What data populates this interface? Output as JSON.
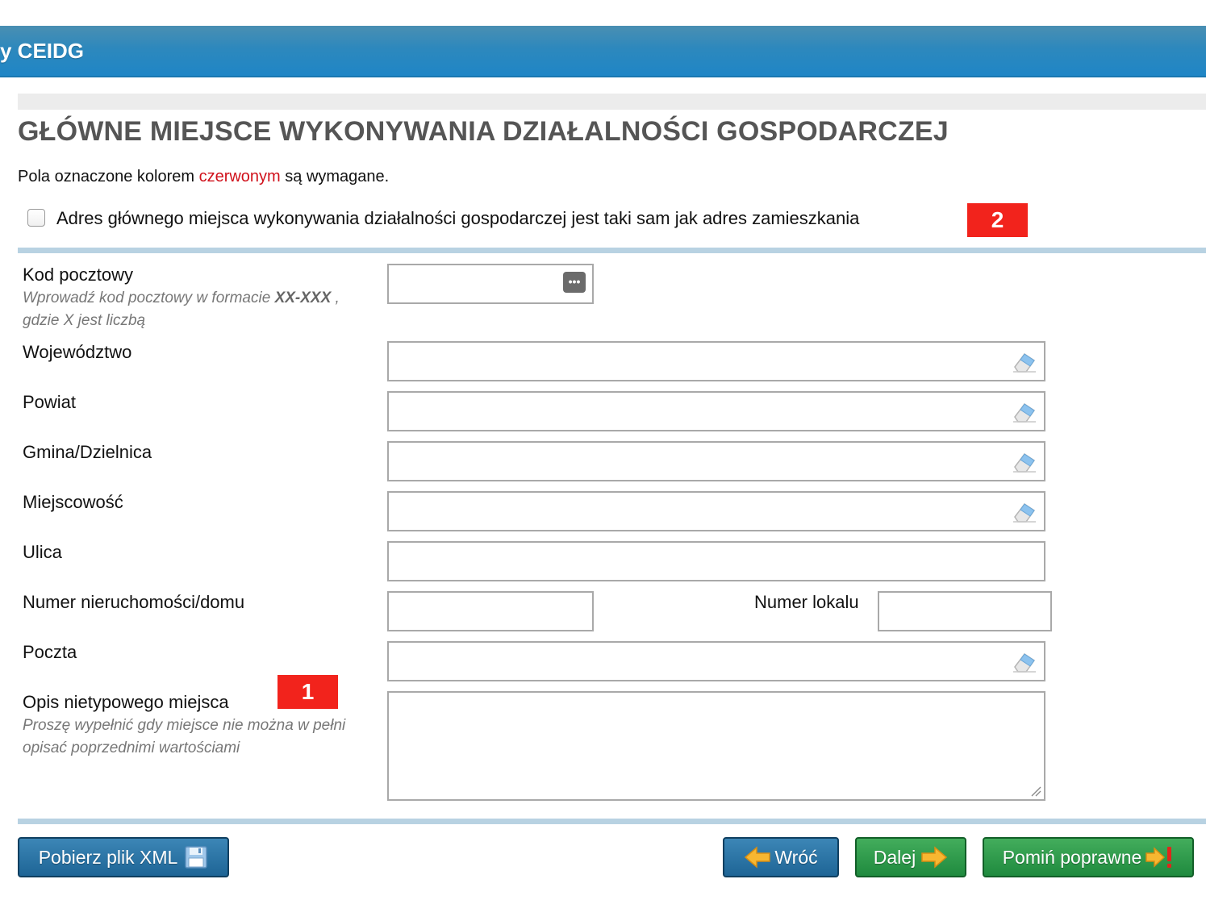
{
  "header": {
    "title": "y CEIDG"
  },
  "section": {
    "heading": "GŁÓWNE MIEJSCE WYKONYWANIA DZIAŁALNOŚCI GOSPODARCZEJ",
    "note_prefix": "Pola oznaczone kolorem ",
    "note_required_word": "czerwonym",
    "note_suffix": " są wymagane.",
    "required_color": "#d0111b"
  },
  "same_address": {
    "label": "Adres głównego miejsca wykonywania działalności gospodarczej jest taki sam jak adres zamieszkania",
    "checked": false
  },
  "badges": {
    "badge_2": "2",
    "badge_1": "1"
  },
  "form": {
    "kod_pocztowy": {
      "label": "Kod pocztowy",
      "hint_1": "Wprowadź kod pocztowy w formacie ",
      "hint_format": "XX-XXX",
      "hint_2": " ,",
      "hint_3": "gdzie X jest liczbą",
      "value": ""
    },
    "wojewodztwo": {
      "label": "Województwo",
      "value": ""
    },
    "powiat": {
      "label": "Powiat",
      "value": ""
    },
    "gmina": {
      "label": "Gmina/Dzielnica",
      "value": ""
    },
    "miejscowosc": {
      "label": "Miejscowość",
      "value": ""
    },
    "ulica": {
      "label": "Ulica",
      "value": ""
    },
    "numer_domu": {
      "label": "Numer nieruchomości/domu",
      "value": ""
    },
    "numer_lokalu": {
      "label": "Numer lokalu",
      "value": ""
    },
    "poczta": {
      "label": "Poczta",
      "value": ""
    },
    "opis": {
      "label": "Opis nietypowego miejsca",
      "hint_1": "Proszę wypełnić gdy miejsce nie można w pełni",
      "hint_2": "opisać poprzednimi wartościami",
      "value": ""
    }
  },
  "buttons": {
    "download_xml": "Pobierz plik XML",
    "back": "Wróć",
    "next": "Dalej",
    "skip_valid": "Pomiń poprawne"
  },
  "icons": {
    "eraser": "eraser-icon",
    "dots": "ellipsis-icon",
    "floppy": "floppy-disk-icon",
    "arrow_left": "arrow-left-icon",
    "arrow_right": "arrow-right-icon",
    "arrow_exclaim": "arrow-right-exclamation-icon"
  }
}
